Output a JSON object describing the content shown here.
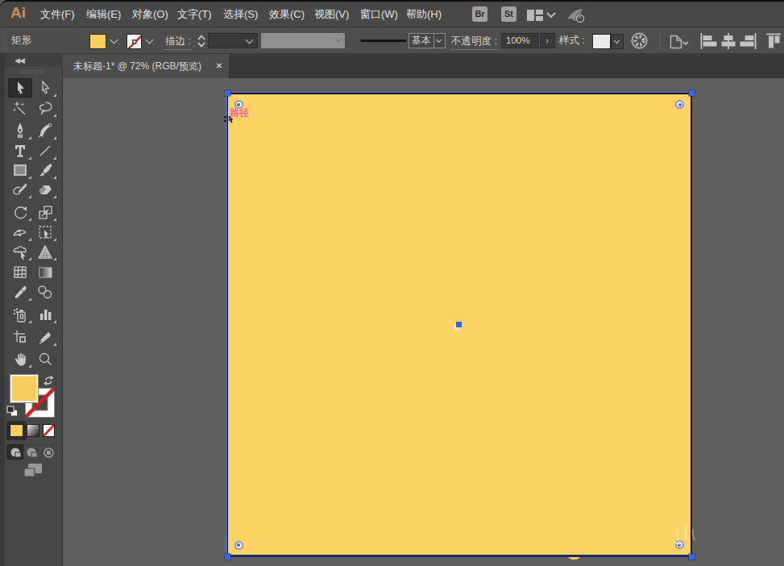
{
  "app": {
    "logo": "Ai",
    "menu": [
      "文件(F)",
      "编辑(E)",
      "对象(O)",
      "文字(T)",
      "选择(S)",
      "效果(C)",
      "视图(V)",
      "窗口(W)",
      "帮助(H)"
    ],
    "bridge_button": "Br",
    "stock_button": "St"
  },
  "control_bar": {
    "context_label": "矩形",
    "stroke_label": "描边 :",
    "brush_definition": "基本",
    "opacity_label": "不透明度 :",
    "opacity_value": "100%",
    "style_label": "样式 :"
  },
  "document_tab": {
    "title": "未标题-1* @ 72% (RGB/预览)",
    "close_glyph": "✕"
  },
  "icons": {
    "collapse_panel_glyph": "◀◀",
    "opacity_expand_glyph": "›"
  },
  "canvas": {
    "smart_guide_label": "路径",
    "zoom_percent": "72%",
    "color_mode": "RGB/预览"
  },
  "colors": {
    "artwork_fill": "#fbd365",
    "selection_blue": "#3b66dd",
    "smart_guide_pink": "#f0679e",
    "pasteboard": "#5f5f5f",
    "ui_chrome": "#3d3d3d",
    "logo_orange": "#d9924b"
  }
}
